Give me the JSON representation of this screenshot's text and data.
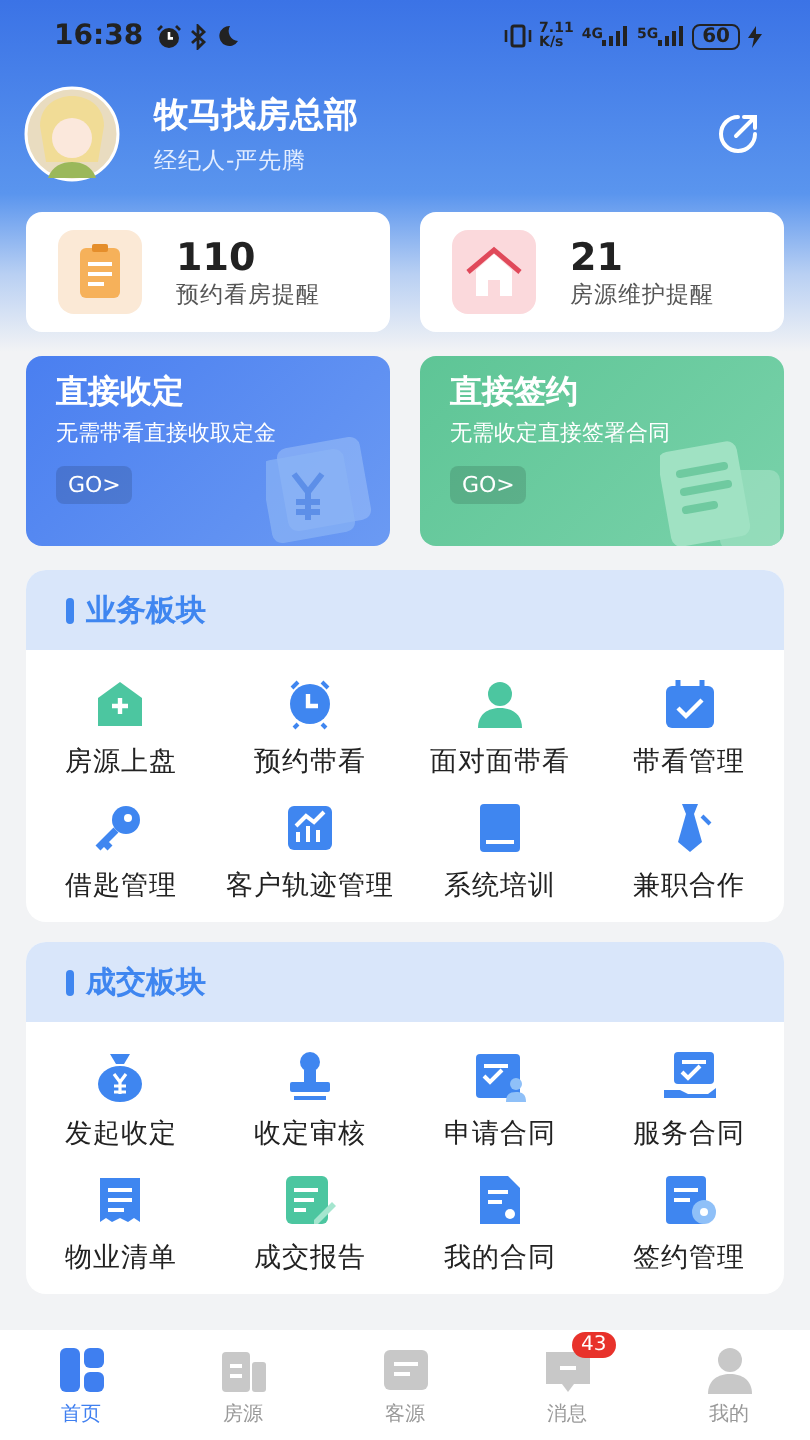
{
  "status_bar": {
    "time": "16:38",
    "speed": "7.11",
    "speed_unit": "K/s",
    "network_1": "4G",
    "network_2": "5G",
    "battery": "60"
  },
  "profile": {
    "name": "牧马找房总部",
    "role": "经纪人-严先腾"
  },
  "reminders": [
    {
      "count": "110",
      "label": "预约看房提醒"
    },
    {
      "count": "21",
      "label": "房源维护提醒"
    }
  ],
  "promos": [
    {
      "title": "直接收定",
      "subtitle": "无需带看直接收取定金",
      "button": "GO>",
      "kind": "deposit"
    },
    {
      "title": "直接签约",
      "subtitle": "无需收定直接签署合同",
      "button": "GO>",
      "kind": "contract"
    }
  ],
  "sections": [
    {
      "title": "业务板块",
      "items": [
        "房源上盘",
        "预约带看",
        "面对面带看",
        "带看管理",
        "借匙管理",
        "客户轨迹管理",
        "系统培训",
        "兼职合作"
      ]
    },
    {
      "title": "成交板块",
      "items": [
        "发起收定",
        "收定审核",
        "申请合同",
        "服务合同",
        "物业清单",
        "成交报告",
        "我的合同",
        "签约管理"
      ]
    }
  ],
  "tab_bar": [
    {
      "label": "首页",
      "selected": true
    },
    {
      "label": "房源",
      "selected": false
    },
    {
      "label": "客源",
      "selected": false
    },
    {
      "label": "消息",
      "selected": false,
      "badge": "43"
    },
    {
      "label": "我的",
      "selected": false
    }
  ]
}
